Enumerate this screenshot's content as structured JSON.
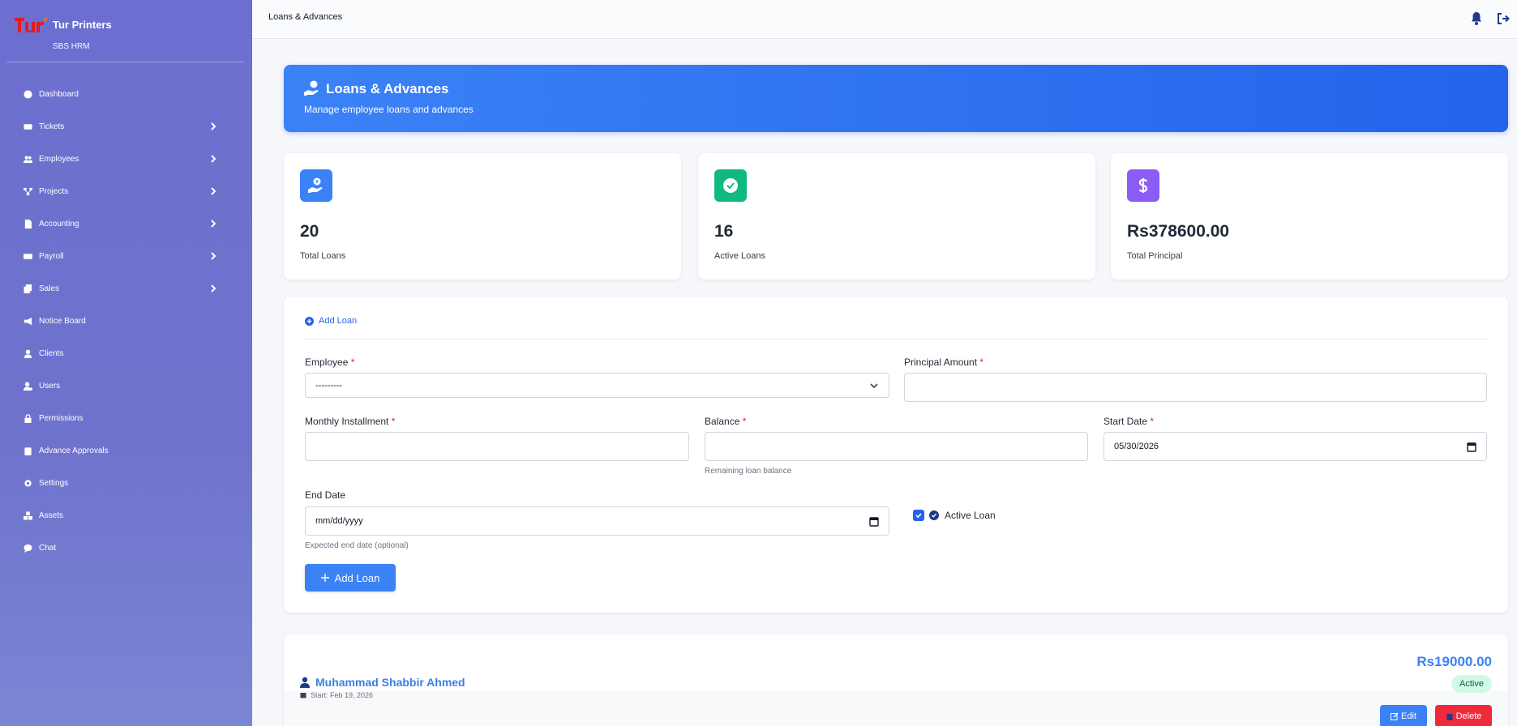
{
  "sidebar": {
    "brand": "Tur Printers",
    "subtitle": "SBS HRM",
    "items": [
      {
        "label": "Dashboard",
        "icon": "dashboard-icon",
        "has_children": false
      },
      {
        "label": "Tickets",
        "icon": "ticket-icon",
        "has_children": true
      },
      {
        "label": "Employees",
        "icon": "users-icon",
        "has_children": true
      },
      {
        "label": "Projects",
        "icon": "sitemap-icon",
        "has_children": true
      },
      {
        "label": "Accounting",
        "icon": "file-icon",
        "has_children": true
      },
      {
        "label": "Payroll",
        "icon": "money-icon",
        "has_children": true
      },
      {
        "label": "Sales",
        "icon": "copy-icon",
        "has_children": true
      },
      {
        "label": "Notice Board",
        "icon": "bullhorn-icon",
        "has_children": false
      },
      {
        "label": "Clients",
        "icon": "user-icon",
        "has_children": false
      },
      {
        "label": "Users",
        "icon": "user-gear-icon",
        "has_children": false
      },
      {
        "label": "Permissions",
        "icon": "lock-icon",
        "has_children": false
      },
      {
        "label": "Advance Approvals",
        "icon": "clipboard-check-icon",
        "has_children": false
      },
      {
        "label": "Settings",
        "icon": "gear-icon",
        "has_children": false
      },
      {
        "label": "Assets",
        "icon": "boxes-icon",
        "has_children": false
      },
      {
        "label": "Chat",
        "icon": "comment-icon",
        "has_children": false
      }
    ]
  },
  "topbar": {
    "breadcrumb": "Loans & Advances"
  },
  "hero": {
    "title": "Loans & Advances",
    "subtitle": "Manage employee loans and advances"
  },
  "stats": [
    {
      "value": "20",
      "label": "Total Loans",
      "color": "#3b82f6",
      "icon": "hand-dollar-icon"
    },
    {
      "value": "16",
      "label": "Active Loans",
      "color": "#10b981",
      "icon": "check-circle-icon"
    },
    {
      "value": "Rs378600.00",
      "label": "Total Principal",
      "color": "#8b5cf6",
      "icon": "dollar-icon"
    }
  ],
  "form": {
    "heading": "Add Loan",
    "employee_label": "Employee",
    "employee_value": "---------",
    "principal_label": "Principal Amount",
    "principal_value": "",
    "installment_label": "Monthly Installment",
    "installment_value": "",
    "balance_label": "Balance",
    "balance_value": "",
    "balance_help": "Remaining loan balance",
    "start_label": "Start Date",
    "start_value": "05/30/2026",
    "end_label": "End Date",
    "end_value": "mm/dd/yyyy",
    "end_help": "Expected end date (optional)",
    "active_label": "Active Loan",
    "active_checked": true,
    "required_mark": "*",
    "submit_label": "Add Loan"
  },
  "loans": [
    {
      "employee": "Muhammad Shabbir Ahmed",
      "start": "Start: Feb 19, 2026",
      "amount": "Rs19000.00",
      "status": "Active",
      "edit_label": "Edit",
      "delete_label": "Delete"
    }
  ]
}
